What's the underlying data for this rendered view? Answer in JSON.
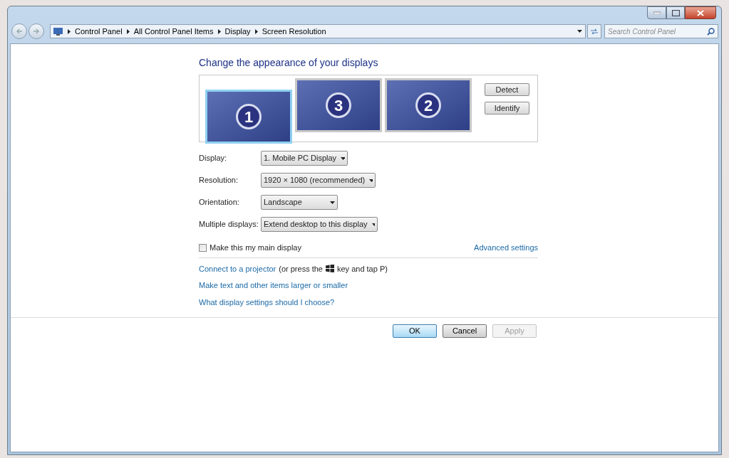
{
  "address_bar": {
    "breadcrumbs": [
      "Control Panel",
      "All Control Panel Items",
      "Display",
      "Screen Resolution"
    ]
  },
  "search": {
    "placeholder": "Search Control Panel"
  },
  "heading": "Change the appearance of your displays",
  "monitors": [
    {
      "label": "1",
      "selected": true
    },
    {
      "label": "3",
      "selected": false
    },
    {
      "label": "2",
      "selected": false
    }
  ],
  "side_buttons": [
    "Detect",
    "Identify"
  ],
  "settings": [
    {
      "label": "Display:",
      "value": "1. Mobile PC Display"
    },
    {
      "label": "Resolution:",
      "value": "1920 × 1080 (recommended)"
    },
    {
      "label": "Orientation:",
      "value": "Landscape"
    },
    {
      "label": "Multiple displays:",
      "value": "Extend desktop to this display"
    }
  ],
  "main_display": {
    "label": "Make this my main display",
    "checked": false
  },
  "advanced_link": "Advanced settings",
  "projector": {
    "link": "Connect to a projector",
    "before_key": "(or press the",
    "after_key": "key and tap P)"
  },
  "links": [
    "Make text and other items larger or smaller",
    "What display settings should I choose?"
  ],
  "buttons": [
    {
      "label": "OK",
      "kind": "default"
    },
    {
      "label": "Cancel",
      "kind": "normal"
    },
    {
      "label": "Apply",
      "kind": "disabled"
    }
  ]
}
